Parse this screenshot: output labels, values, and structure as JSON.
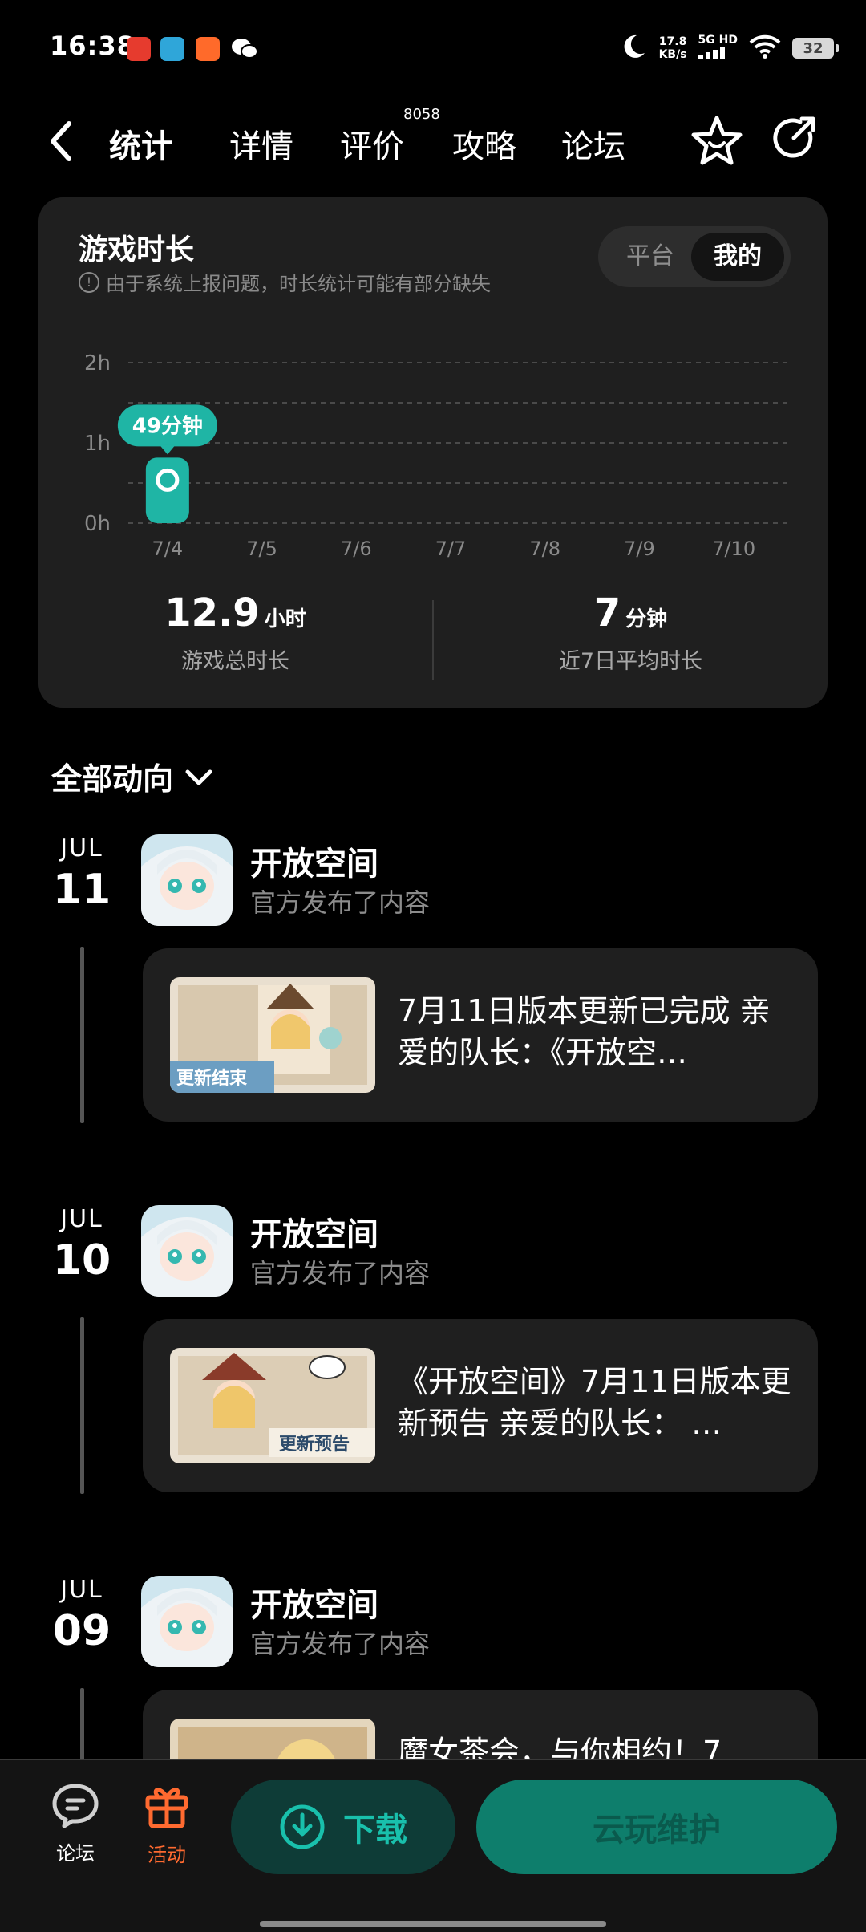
{
  "status_bar": {
    "time": "16:38",
    "net_speed": "17.8",
    "net_unit": "KB/s",
    "network": "5G HD",
    "battery": "32"
  },
  "nav": {
    "tabs": [
      {
        "label": "统计",
        "active": true
      },
      {
        "label": "详情"
      },
      {
        "label": "评价"
      },
      {
        "label": "攻略"
      },
      {
        "label": "论坛"
      }
    ],
    "review_count": "8058"
  },
  "stats": {
    "title": "游戏时长",
    "note": "由于系统上报问题，时长统计可能有部分缺失",
    "toggle": {
      "platform": "平台",
      "mine": "我的"
    },
    "total_value": "12.9",
    "total_unit": "小时",
    "total_label": "游戏总时长",
    "avg_value": "7",
    "avg_unit": "分钟",
    "avg_label": "近7日平均时长"
  },
  "chart_data": {
    "type": "bar",
    "categories": [
      "7/4",
      "7/5",
      "7/6",
      "7/7",
      "7/8",
      "7/9",
      "7/10"
    ],
    "values": [
      49,
      0,
      0,
      0,
      0,
      0,
      0
    ],
    "unit": "minutes",
    "yticks": [
      "2h",
      "1h",
      "0h"
    ],
    "ylim": [
      0,
      120
    ],
    "highlight_label": "49分钟",
    "accent": "#1fb5a5",
    "grid": true
  },
  "feed": {
    "header": "全部动向",
    "items": [
      {
        "month": "JUL",
        "day": "11",
        "author": "开放空间",
        "action": "官方发布了内容",
        "text": "7月11日版本更新已完成 亲爱的队长：《开放空…",
        "thumb_label": "更新结束"
      },
      {
        "month": "JUL",
        "day": "10",
        "author": "开放空间",
        "action": "官方发布了内容",
        "text": "《开放空间》7月11日版本更新预告 亲爱的队长： …",
        "thumb_label": "更新预告"
      },
      {
        "month": "JUL",
        "day": "09",
        "author": "开放空间",
        "action": "官方发布了内容",
        "text": "魔女茶会，与你相约！7",
        "thumb_label": ""
      }
    ]
  },
  "bottom_bar": {
    "forum_label": "论坛",
    "activity_label": "活动",
    "download_label": "下载",
    "cloud_label": "云玩维护"
  }
}
